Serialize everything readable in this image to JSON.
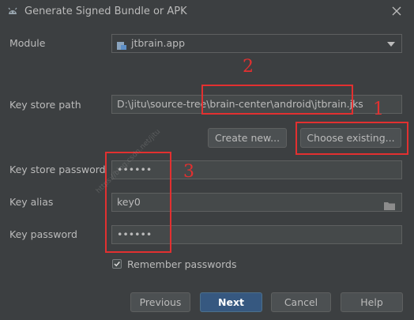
{
  "dialog": {
    "title": "Generate Signed Bundle or APK",
    "icon": "android-icon",
    "close_icon": "close-icon"
  },
  "module": {
    "label": "Module",
    "value": "jtbrain.app",
    "icon": "module-folder-icon"
  },
  "key_store_path": {
    "label": "Key store path",
    "value": "D:\\jitu\\source-tree\\brain-center\\android\\jtbrain.jks"
  },
  "buttons": {
    "create_new": "Create new...",
    "choose_existing": "Choose existing...",
    "previous": "Previous",
    "next": "Next",
    "cancel": "Cancel",
    "help": "Help"
  },
  "key_store_password": {
    "label": "Key store password",
    "value": "••••••"
  },
  "key_alias": {
    "label": "Key alias",
    "value": "key0",
    "icon": "folder-icon"
  },
  "key_password": {
    "label": "Key password",
    "value": "••••••"
  },
  "remember": {
    "label": "Remember passwords",
    "checked": true
  },
  "annotations": {
    "one": "1",
    "two": "2",
    "three": "3",
    "color": "#e23030"
  },
  "watermark": "https://blog.csdn.net/jitu"
}
